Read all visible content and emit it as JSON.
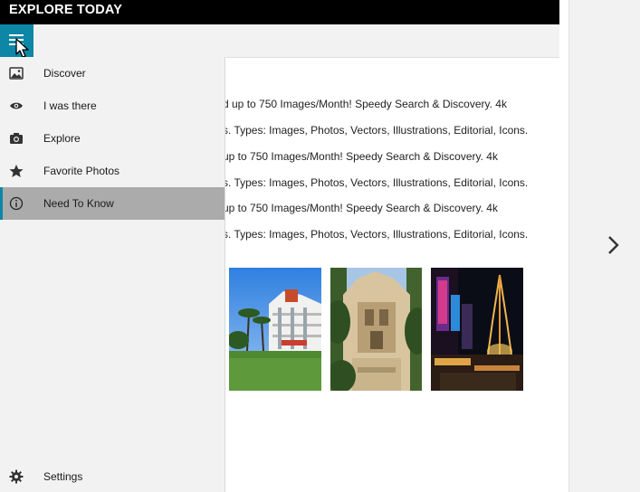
{
  "app": {
    "title": "EXPLORE TODAY"
  },
  "nav": {
    "items": [
      {
        "label": "Discover",
        "icon": "image-icon"
      },
      {
        "label": "I was there",
        "icon": "eye-icon"
      },
      {
        "label": "Explore",
        "icon": "camera-icon"
      },
      {
        "label": "Favorite Photos",
        "icon": "star-icon"
      },
      {
        "label": "Need To Know",
        "icon": "info-icon",
        "selected": true
      }
    ],
    "settings": {
      "label": "Settings",
      "icon": "gear-icon"
    }
  },
  "content": {
    "lines": [
      "d up to 750 Images/Month! Speedy Search & Discovery. 4k",
      "s. Types: Images, Photos, Vectors, Illustrations, Editorial, Icons.",
      "up to 750 Images/Month! Speedy Search & Discovery. 4k",
      "s. Types: Images, Photos, Vectors, Illustrations, Editorial, Icons.",
      "up to 750 Images/Month! Speedy Search & Discovery. 4k",
      "s. Types: Images, Photos, Vectors, Illustrations, Editorial, Icons."
    ],
    "photos": [
      {
        "name": "hotel-photo"
      },
      {
        "name": "cathedral-photo"
      },
      {
        "name": "las-vegas-photo"
      }
    ]
  },
  "colors": {
    "accent": "#0e87a6",
    "selected_bg": "#ababab",
    "titlebar": "#000000"
  }
}
